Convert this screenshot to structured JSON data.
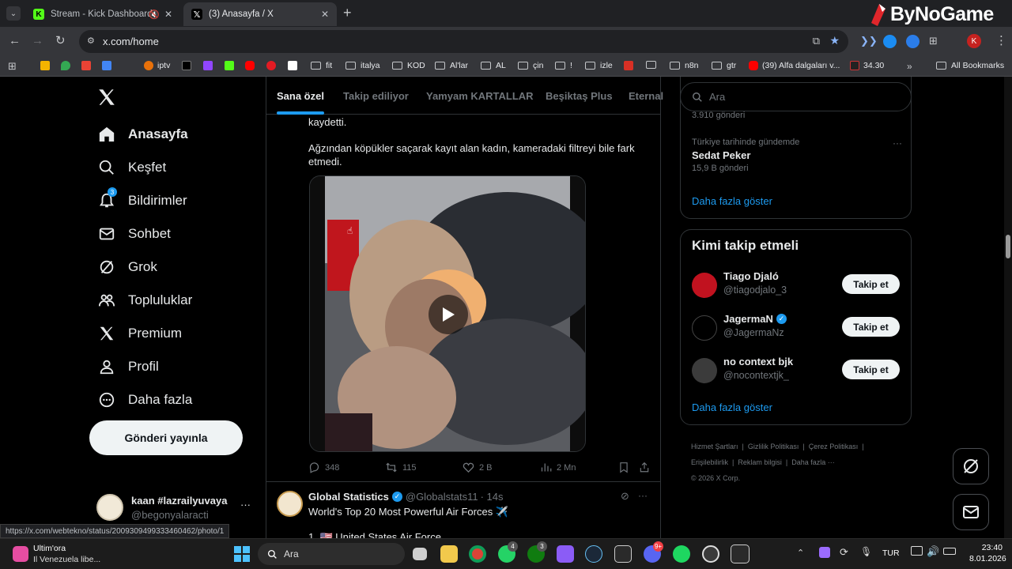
{
  "browser": {
    "tabs": [
      {
        "title": "Stream - Kick Dashboard"
      },
      {
        "title": "(3) Anasayfa / X"
      }
    ],
    "url": "x.com/home",
    "status_url": "https://x.com/webtekno/status/2009309499333460462/photo/1",
    "profile_initial": "K",
    "bookmarks": [
      "iptv",
      "fit",
      "italya",
      "KOD",
      "Al'lar",
      "AL",
      "çin",
      "!",
      "izle",
      "n8n",
      "gtr",
      "(39) Alfa dalgaları v...",
      "34.30",
      "All Bookmarks"
    ]
  },
  "watermark": "ByNoGame",
  "nav": {
    "items": [
      "Anasayfa",
      "Keşfet",
      "Bildirimler",
      "Sohbet",
      "Grok",
      "Topluluklar",
      "Premium",
      "Profil",
      "Daha fazla"
    ],
    "notification_count": "3",
    "post_button": "Gönderi yayınla",
    "account_name": "kaan #lazrailyuvaya",
    "account_handle": "@begonyalaracti"
  },
  "feed": {
    "tabs": [
      "Sana özel",
      "Takip ediliyor",
      "Yamyam KARTALLAR",
      "Beşiktaş Plus",
      "Eternal"
    ],
    "post1": {
      "text_top": "kaydetti.",
      "text_main": "Ağzından köpükler saçarak kayıt alan kadın, kameradaki filtreyi bile fark etmedi.",
      "replies": "348",
      "reposts": "115",
      "likes": "2 B",
      "views": "2 Mn"
    },
    "post2": {
      "author": "Global Statistics",
      "handle": "@Globalstats11",
      "time": "· 14s",
      "text": "World's Top 20 Most Powerful Air Forces ✈️",
      "next_line": "1. 🇺🇸 United States Air Force"
    }
  },
  "right": {
    "search_placeholder": "Ara",
    "trend_prev_count": "3.910 gönderi",
    "trend": {
      "context": "Türkiye tarihinde gündemde",
      "name": "Sedat Peker",
      "count": "15,9 B gönderi"
    },
    "show_more": "Daha fazla göster",
    "who_to_follow_title": "Kimi takip etmeli",
    "suggestions": [
      {
        "name": "Tiago Djaló",
        "handle": "@tiagodjalo_3",
        "verified": false
      },
      {
        "name": "JagermaN",
        "handle": "@JagermaNz",
        "verified": true
      },
      {
        "name": "no context bjk",
        "handle": "@nocontextjk_",
        "verified": false
      }
    ],
    "follow_label": "Takip et",
    "footer": [
      "Hizmet Şartları",
      "Gizlilik Politikası",
      "Çerez Politikası",
      "Erişilebilirlik",
      "Reklam bilgisi",
      "Daha fazla ···",
      "© 2026 X Corp."
    ]
  },
  "taskbar": {
    "news_title": "Ultim'ora",
    "news_text": "Il Venezuela libe...",
    "search_label": "Ara",
    "lang": "TUR",
    "time": "23:40",
    "date": "8.01.2026",
    "badges": [
      "4",
      "3",
      "9+"
    ]
  }
}
